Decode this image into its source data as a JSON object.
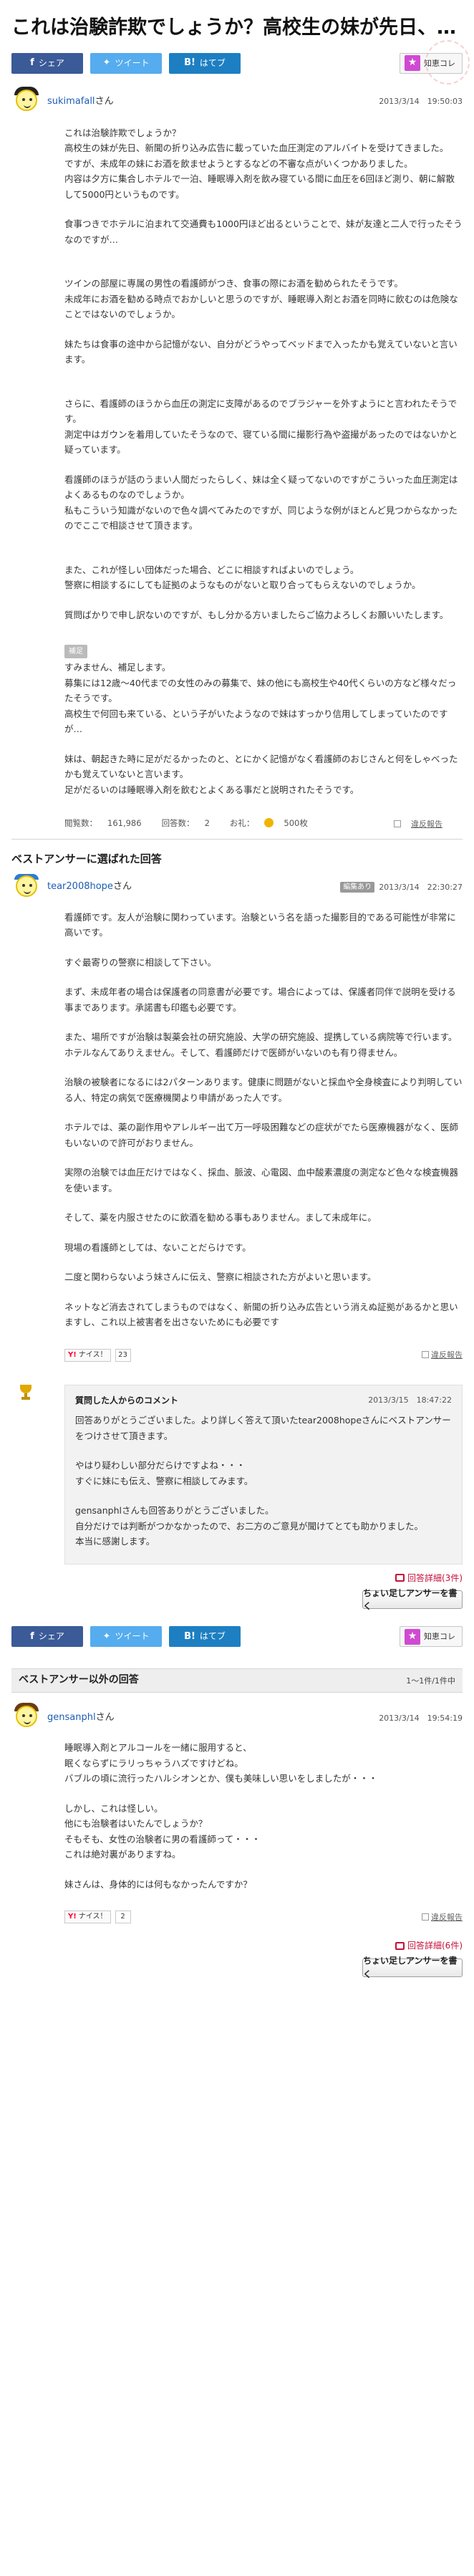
{
  "question": {
    "title": "これは治験詐欺でしょうか？高校生の妹が先日、…",
    "user": "sukimafall",
    "honorific": "さん",
    "date": "2013/3/14",
    "time": "19:50:03",
    "paragraphs": [
      "これは治験詐欺でしょうか？\n高校生の妹が先日、新聞の折り込み広告に載っていた血圧測定のアルバイトを受けてきました。\nですが、未成年の妹にお酒を飲ませようとするなどの不審な点がいくつかありました。\n内容は夕方に集合しホテルで一泊、睡眠導入剤を飲み寝ている間に血圧を6回ほど測り、朝に解散して5000円というものです。",
      "食事つきでホテルに泊まれて交通費も1000円ほど出るということで、妹が友達と二人で行ったそうなのですが…",
      "ツインの部屋に専属の男性の看護師がつき、食事の際にお酒を勧められたそうです。\n未成年にお酒を勧める時点でおかしいと思うのですが、睡眠導入剤とお酒を同時に飲むのは危険なことではないのでしょうか。",
      "妹たちは食事の途中から記憶がない、自分がどうやってベッドまで入ったかも覚えていないと言います。",
      "さらに、看護師のほうから血圧の測定に支障があるのでブラジャーを外すようにと言われたそうです。\n測定中はガウンを着用していたそうなので、寝ている間に撮影行為や盗撮があったのではないかと疑っています。",
      "看護師のほうが話のうまい人間だったらしく、妹は全く疑ってないのですがこういった血圧測定はよくあるものなのでしょうか。\n私もこういう知識がないので色々調べてみたのですが、同じような例がほとんど見つからなかったのでここで相談させて頂きます。",
      "また、これが怪しい団体だった場合、どこに相談すればよいのでしょう。\n警察に相談するにしても証拠のようなものがないと取り合ってもらえないのでしょうか。",
      "質問ばかりで申し訳ないのですが、もし分かる方いましたらご協力よろしくお願いいたします。"
    ],
    "supplement_label": "補足",
    "supplement": [
      "すみません、補足します。\n募集には12歳〜40代までの女性のみの募集で、妹の他にも高校生や40代くらいの方など様々だったそうです。\n高校生で何回も来ている、という子がいたようなので妹はすっかり信用してしまっていたのですが…",
      "妹は、朝起きた時に足がだるかったのと、とにかく記憶がなく看護師のおじさんと何をしゃべったかも覚えていないと言います。\n足がだるいのは睡眠導入剤を飲むとよくある事だと説明されたそうです。"
    ],
    "views_label": "閲覧数：",
    "views": "161,986",
    "answers_label": "回答数：",
    "answers": "2",
    "reward_label": "お礼：",
    "reward": "500枚",
    "report": "違反報告"
  },
  "share": {
    "facebook": "シェア",
    "twitter": "ツイート",
    "hatena": "はてブ",
    "hatena_glyph": "B!",
    "chie": "知恵コレ"
  },
  "best_answer": {
    "heading": "ベストアンサーに選ばれた回答",
    "user": "tear2008hope",
    "honorific": "さん",
    "tag": "編集あり",
    "date": "2013/3/14",
    "time": "22:30:27",
    "paragraphs": [
      "看護師です。友人が治験に関わっています。治験という名を語った撮影目的である可能性が非常に高いです。",
      "すぐ最寄りの警察に相談して下さい。",
      "まず、未成年者の場合は保護者の同意書が必要です。場合によっては、保護者同伴で説明を受ける事まであります。承諾書も印鑑も必要です。",
      "また、場所ですが治験は製薬会社の研究施設、大学の研究施設、提携している病院等で行います。ホテルなんてありえません。そして、看護師だけで医師がいないのも有り得ません。",
      "治験の被験者になるには2パターンあります。健康に問題がないと採血や全身検査により判明している人、特定の病気で医療機関より申請があった人です。",
      "ホテルでは、薬の副作用やアレルギー出て万一呼吸困難などの症状がでたら医療機器がなく、医師もいないので許可がおりません。",
      "実際の治験では血圧だけではなく、採血、脈波、心電図、血中酸素濃度の測定など色々な検査機器を使います。",
      "そして、薬を内服させたのに飲酒を勧める事もありません。まして未成年に。",
      "現場の看護師としては、ないことだらけです。",
      "二度と関わらないよう妹さんに伝え、警察に相談された方がよいと思います。",
      "ネットなど消去されてしまうものではなく、新聞の折り込み広告という消えぬ証拠があるかと思いますし、これ以上被害者を出さないためにも必要です"
    ],
    "yj_label": "ナイス！",
    "nice_count": "23",
    "report": "違反報告"
  },
  "asker_comment": {
    "title": "質問した人からのコメント",
    "date": "2013/3/15",
    "time": "18:47:22",
    "paragraphs": [
      "回答ありがとうございました。より詳しく答えて頂いたtear2008hopeさんにベストアンサーをつけさせて頂きます。",
      "やはり疑わしい部分だらけですよね・・・\nすぐに妹にも伝え、警察に相談してみます。",
      "gensanphlさんも回答ありがとうございました。\n自分だけでは判断がつかなかったので、お二方のご意見が聞けてとても助かりました。\n本当に感謝します。"
    ],
    "detail_link": "回答詳細",
    "detail_count": "(3件)",
    "reply_button": "ちょい足しアンサーを書く"
  },
  "other_answers": {
    "heading": "ベストアンサー以外の回答",
    "pagination": "1〜1件/1件中",
    "items": [
      {
        "user": "gensanphl",
        "honorific": "さん",
        "date": "2013/3/14",
        "time": "19:54:19",
        "paragraphs": [
          "睡眠導入剤とアルコールを一緒に服用すると、\n眠くならずにラリっちゃうハズですけどね。\nバブルの頃に流行ったハルシオンとか、僕も美味しい思いをしましたが・・・",
          "しかし、これは怪しい。\n他にも治験者はいたんでしょうか？\nそもそも、女性の治験者に男の看護師って・・・\nこれは絶対裏がありますね。",
          "妹さんは、身体的には何もなかったんですか？"
        ],
        "yj_label": "ナイス！",
        "nice_count": "2",
        "report": "違反報告",
        "detail_link": "回答詳細",
        "detail_count": "(6件)",
        "reply_button": "ちょい足しアンサーを書く"
      }
    ]
  }
}
